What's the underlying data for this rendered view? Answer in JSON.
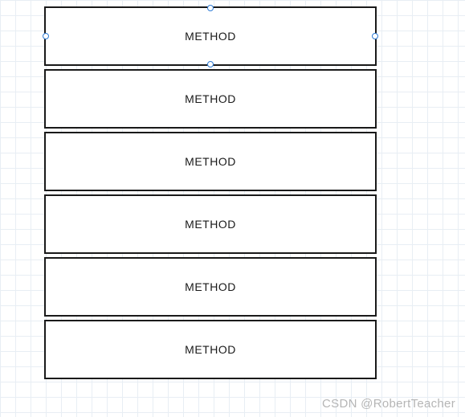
{
  "boxes": [
    {
      "label": "METHOD",
      "selected": true
    },
    {
      "label": "METHOD",
      "selected": false
    },
    {
      "label": "METHOD",
      "selected": false
    },
    {
      "label": "METHOD",
      "selected": false
    },
    {
      "label": "METHOD",
      "selected": false
    },
    {
      "label": "METHOD",
      "selected": false
    }
  ],
  "watermark": "CSDN @RobertTeacher"
}
